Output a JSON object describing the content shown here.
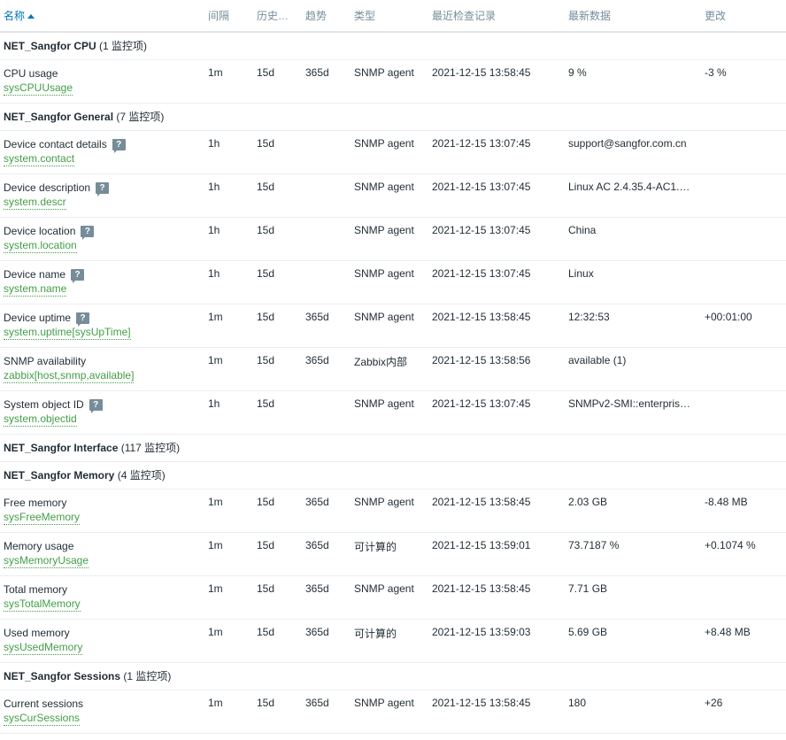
{
  "columns": {
    "name": "名称",
    "interval": "间隔",
    "history": "历史…",
    "trends": "趋势",
    "type": "类型",
    "last_check": "最近检查记录",
    "last_value": "最新数据",
    "change": "更改"
  },
  "groups": [
    {
      "name": "NET_Sangfor CPU",
      "count": "(1 监控项)",
      "items": [
        {
          "name": "CPU usage",
          "key": "sysCPUUsage",
          "help": false,
          "interval": "1m",
          "history": "15d",
          "trends": "365d",
          "type": "SNMP agent",
          "last_check": "2021-12-15 13:58:45",
          "last_value": "9 %",
          "change": "-3 %"
        }
      ]
    },
    {
      "name": "NET_Sangfor General",
      "count": "(7 监控项)",
      "items": [
        {
          "name": "Device contact details",
          "key": "system.contact",
          "help": true,
          "interval": "1h",
          "history": "15d",
          "trends": "",
          "type": "SNMP agent",
          "last_check": "2021-12-15 13:07:45",
          "last_value": "support@sangfor.com.cn",
          "change": ""
        },
        {
          "name": "Device description",
          "key": "system.descr",
          "help": true,
          "interval": "1h",
          "history": "15d",
          "trends": "",
          "type": "SNMP agent",
          "last_check": "2021-12-15 13:07:45",
          "last_value": "Linux AC 2.4.35.4-AC1.…",
          "change": ""
        },
        {
          "name": "Device location",
          "key": "system.location",
          "help": true,
          "interval": "1h",
          "history": "15d",
          "trends": "",
          "type": "SNMP agent",
          "last_check": "2021-12-15 13:07:45",
          "last_value": "China",
          "change": ""
        },
        {
          "name": "Device name",
          "key": "system.name",
          "help": true,
          "interval": "1h",
          "history": "15d",
          "trends": "",
          "type": "SNMP agent",
          "last_check": "2021-12-15 13:07:45",
          "last_value": "Linux",
          "change": ""
        },
        {
          "name": "Device uptime",
          "key": "system.uptime[sysUpTime]",
          "help": true,
          "interval": "1m",
          "history": "15d",
          "trends": "365d",
          "type": "SNMP agent",
          "last_check": "2021-12-15 13:58:45",
          "last_value": "12:32:53",
          "change": "+00:01:00"
        },
        {
          "name": "SNMP availability",
          "key": "zabbix[host,snmp,available]",
          "help": false,
          "interval": "1m",
          "history": "15d",
          "trends": "365d",
          "type": "Zabbix内部",
          "last_check": "2021-12-15 13:58:56",
          "last_value": "available (1)",
          "change": ""
        },
        {
          "name": "System object ID",
          "key": "system.objectid",
          "help": true,
          "interval": "1h",
          "history": "15d",
          "trends": "",
          "type": "SNMP agent",
          "last_check": "2021-12-15 13:07:45",
          "last_value": "SNMPv2-SMI::enterpris…",
          "change": ""
        }
      ]
    },
    {
      "name": "NET_Sangfor Interface",
      "count": "(117 监控项)",
      "items": []
    },
    {
      "name": "NET_Sangfor Memory",
      "count": "(4 监控项)",
      "items": [
        {
          "name": "Free memory",
          "key": "sysFreeMemory",
          "help": false,
          "interval": "1m",
          "history": "15d",
          "trends": "365d",
          "type": "SNMP agent",
          "last_check": "2021-12-15 13:58:45",
          "last_value": "2.03 GB",
          "change": "-8.48 MB"
        },
        {
          "name": "Memory usage",
          "key": "sysMemoryUsage",
          "help": false,
          "interval": "1m",
          "history": "15d",
          "trends": "365d",
          "type": "可计算的",
          "last_check": "2021-12-15 13:59:01",
          "last_value": "73.7187 %",
          "change": "+0.1074 %"
        },
        {
          "name": "Total memory",
          "key": "sysTotalMemory",
          "help": false,
          "interval": "1m",
          "history": "15d",
          "trends": "365d",
          "type": "SNMP agent",
          "last_check": "2021-12-15 13:58:45",
          "last_value": "7.71 GB",
          "change": ""
        },
        {
          "name": "Used memory",
          "key": "sysUsedMemory",
          "help": false,
          "interval": "1m",
          "history": "15d",
          "trends": "365d",
          "type": "可计算的",
          "last_check": "2021-12-15 13:59:03",
          "last_value": "5.69 GB",
          "change": "+8.48 MB"
        }
      ]
    },
    {
      "name": "NET_Sangfor Sessions",
      "count": "(1 监控项)",
      "items": [
        {
          "name": "Current sessions",
          "key": "sysCurSessions",
          "help": false,
          "interval": "1m",
          "history": "15d",
          "trends": "365d",
          "type": "SNMP agent",
          "last_check": "2021-12-15 13:58:45",
          "last_value": "180",
          "change": "+26"
        }
      ]
    }
  ]
}
